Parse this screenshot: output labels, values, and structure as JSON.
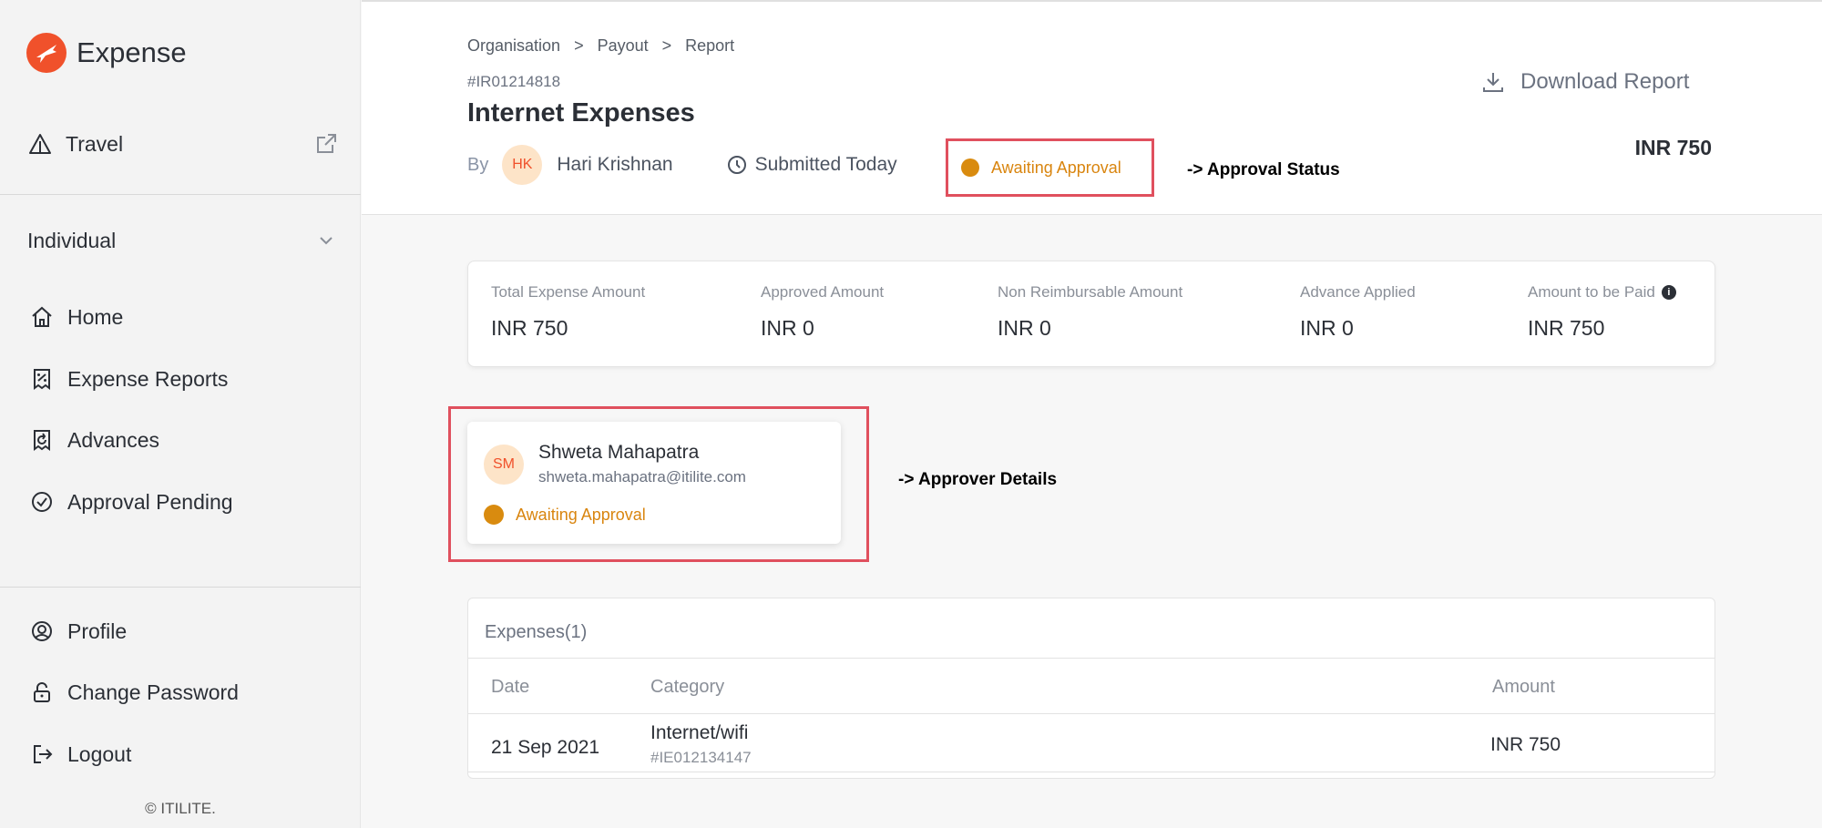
{
  "app": {
    "name": "Expense",
    "brand_color": "#f0512b"
  },
  "sidebar": {
    "travel_label": "Travel",
    "context_select": "Individual",
    "nav": [
      {
        "label": "Home",
        "icon": "home-icon"
      },
      {
        "label": "Expense Reports",
        "icon": "receipt-icon"
      },
      {
        "label": "Advances",
        "icon": "advance-icon"
      },
      {
        "label": "Approval Pending",
        "icon": "check-circle-icon"
      }
    ],
    "account": [
      {
        "label": "Profile",
        "icon": "user-circle-icon"
      },
      {
        "label": "Change Password",
        "icon": "lock-icon"
      },
      {
        "label": "Logout",
        "icon": "logout-icon"
      }
    ],
    "copyright": "© ITILITE."
  },
  "header": {
    "breadcrumb": [
      "Organisation",
      "Payout",
      "Report"
    ],
    "breadcrumb_sep": ">",
    "report_id": "#IR01214818",
    "title": "Internet Expenses",
    "by_label": "By",
    "submitter_initials": "HK",
    "submitter_name": "Hari Krishnan",
    "submitted_text": "Submitted Today",
    "status": "Awaiting Approval",
    "status_color": "#d98b0f",
    "download_label": "Download Report",
    "amount": "INR 750"
  },
  "annotations": {
    "status": "-> Approval Status",
    "approver": "-> Approver Details"
  },
  "summary": [
    {
      "label": "Total Expense Amount",
      "value": "INR 750"
    },
    {
      "label": "Approved Amount",
      "value": "INR 0"
    },
    {
      "label": "Non Reimbursable Amount",
      "value": "INR 0"
    },
    {
      "label": "Advance Applied",
      "value": "INR 0"
    },
    {
      "label": "Amount to be Paid",
      "value": "INR 750"
    }
  ],
  "approver": {
    "initials": "SM",
    "name": "Shweta Mahapatra",
    "email": "shweta.mahapatra@itilite.com",
    "status": "Awaiting Approval"
  },
  "expenses": {
    "title": "Expenses(1)",
    "columns": [
      "Date",
      "Category",
      "Amount"
    ],
    "rows": [
      {
        "date": "21 Sep 2021",
        "category": "Internet/wifi",
        "id": "#IE012134147",
        "amount": "INR 750"
      }
    ]
  }
}
